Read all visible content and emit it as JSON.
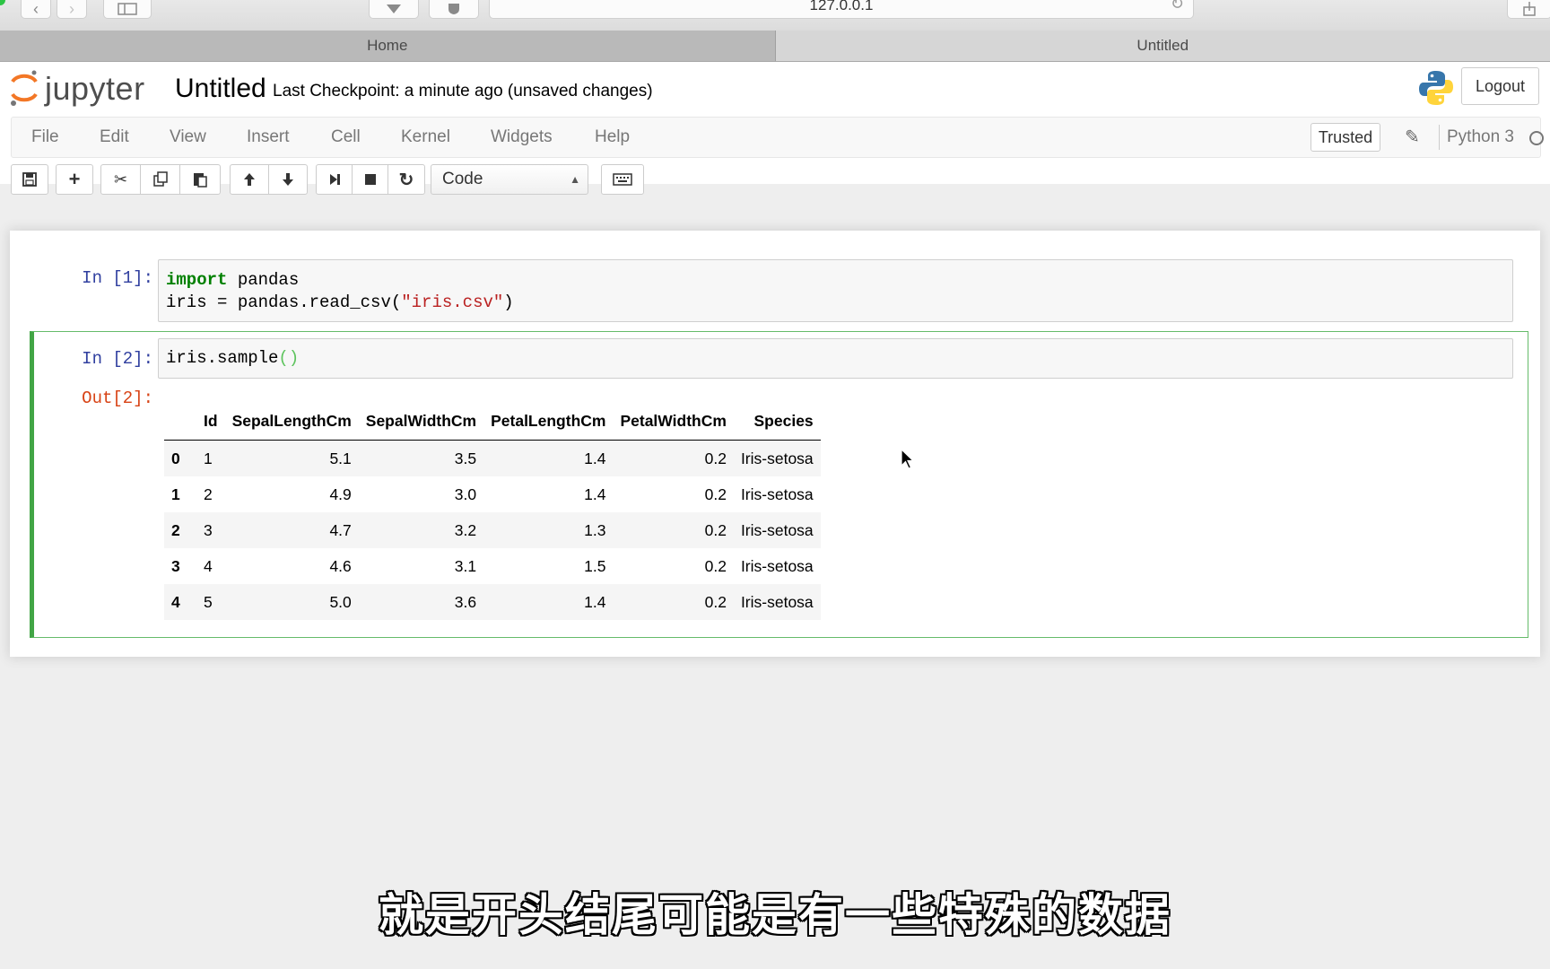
{
  "browser": {
    "url": "127.0.0.1",
    "tabs": [
      {
        "label": "Home",
        "active": false
      },
      {
        "label": "Untitled",
        "active": true
      }
    ]
  },
  "header": {
    "logo_text": "jupyter",
    "notebook_name": "Untitled",
    "checkpoint": "Last Checkpoint: a minute ago (unsaved changes)",
    "logout_label": "Logout"
  },
  "menubar": {
    "items": [
      "File",
      "Edit",
      "View",
      "Insert",
      "Cell",
      "Kernel",
      "Widgets",
      "Help"
    ],
    "trusted_label": "Trusted",
    "kernel_name": "Python 3"
  },
  "toolbar": {
    "cell_type": "Code",
    "buttons": [
      "save-icon",
      "plus-icon",
      "cut-icon",
      "copy-icon",
      "paste-icon",
      "arrow-up-icon",
      "arrow-down-icon",
      "run-icon",
      "stop-icon",
      "restart-icon",
      "keyboard-icon"
    ]
  },
  "cells": [
    {
      "prompt": "In [1]:",
      "code_lines": [
        {
          "kw": "import",
          "rest": " pandas"
        },
        {
          "pre": "iris = pandas.read_csv(",
          "str": "\"iris.csv\"",
          "post": ")"
        }
      ]
    },
    {
      "prompt": "In [2]:",
      "code_pre": "iris.sample",
      "code_parens": "()",
      "out_prompt": "Out[2]:",
      "table": {
        "columns": [
          "",
          "Id",
          "SepalLengthCm",
          "SepalWidthCm",
          "PetalLengthCm",
          "PetalWidthCm",
          "Species"
        ],
        "rows": [
          [
            "0",
            "1",
            "5.1",
            "3.5",
            "1.4",
            "0.2",
            "Iris-setosa"
          ],
          [
            "1",
            "2",
            "4.9",
            "3.0",
            "1.4",
            "0.2",
            "Iris-setosa"
          ],
          [
            "2",
            "3",
            "4.7",
            "3.2",
            "1.3",
            "0.2",
            "Iris-setosa"
          ],
          [
            "3",
            "4",
            "4.6",
            "3.1",
            "1.5",
            "0.2",
            "Iris-setosa"
          ],
          [
            "4",
            "5",
            "5.0",
            "3.6",
            "1.4",
            "0.2",
            "Iris-setosa"
          ]
        ]
      }
    }
  ],
  "subtitle": "就是开头结尾可能是有一些特殊的数据",
  "colors": {
    "in_prompt": "#303f9f",
    "out_prompt": "#d84315",
    "selected_cell_border": "#42a545"
  }
}
